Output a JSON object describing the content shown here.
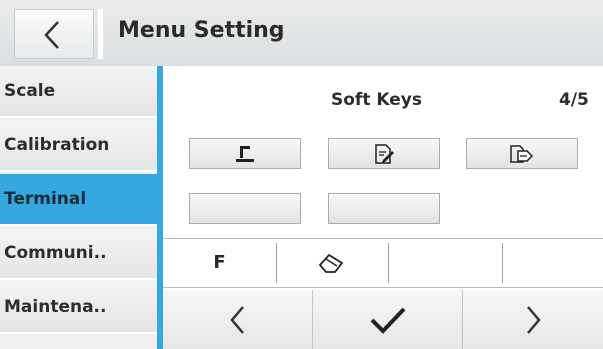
{
  "header": {
    "title": "Menu Setting",
    "back_icon": "chevron-left-icon"
  },
  "sidebar": {
    "items": [
      {
        "label": "Scale",
        "active": false
      },
      {
        "label": "Calibration",
        "active": false
      },
      {
        "label": "Terminal",
        "active": true
      },
      {
        "label": "Communi..",
        "active": false
      },
      {
        "label": "Maintena..",
        "active": false
      }
    ]
  },
  "main": {
    "section_title": "Soft Keys",
    "page": "4/5",
    "key_buttons": [
      {
        "icon": "scale-tare-icon"
      },
      {
        "icon": "edit-document-icon"
      },
      {
        "icon": "transfer-label-icon"
      },
      {
        "icon": ""
      },
      {
        "icon": ""
      }
    ]
  },
  "softkey_bar": {
    "cells": [
      {
        "label": "F"
      },
      {
        "icon": "eraser-icon"
      },
      {
        "label": ""
      },
      {
        "label": ""
      }
    ]
  },
  "nav": {
    "back_icon": "chevron-left-icon",
    "confirm_icon": "checkmark-icon",
    "next_icon": "chevron-right-icon"
  },
  "colors": {
    "accent": "#35a8e0",
    "header_bg": "#e2e4e6"
  }
}
